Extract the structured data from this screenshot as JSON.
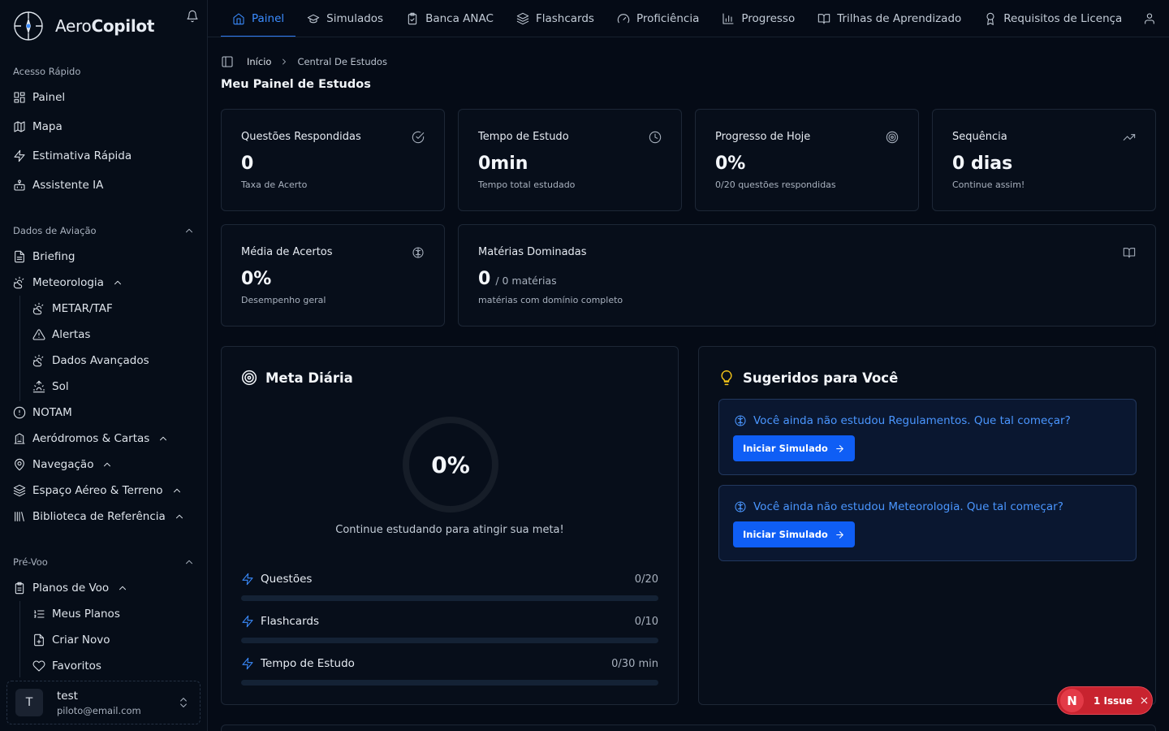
{
  "brand": {
    "name_light": "Aero",
    "name_bold": "Copilot"
  },
  "sidebar": {
    "quick_access_label": "Acesso Rápido",
    "quick_access": [
      {
        "label": "Painel",
        "icon": "grid-icon"
      },
      {
        "label": "Mapa",
        "icon": "map-icon"
      },
      {
        "label": "Estimativa Rápida",
        "icon": "zap-icon"
      },
      {
        "label": "Assistente IA",
        "icon": "bot-icon"
      }
    ],
    "aviation_label": "Dados de Aviação",
    "aviation": {
      "briefing": "Briefing",
      "meteorologia": "Meteorologia",
      "metar": "METAR/TAF",
      "alertas": "Alertas",
      "dados_avancados": "Dados Avançados",
      "sol": "Sol",
      "notam": "NOTAM",
      "aerodromos": "Aeródromos & Cartas",
      "navegacao": "Navegação",
      "espaco_aereo": "Espaço Aéreo & Terreno",
      "biblioteca": "Biblioteca de Referência"
    },
    "preflight_label": "Pré-Voo",
    "preflight": {
      "planos": "Planos de Voo",
      "meus_planos": "Meus Planos",
      "criar_novo": "Criar Novo",
      "favoritos": "Favoritos"
    },
    "user": {
      "initial": "T",
      "name": "test",
      "email": "piloto@email.com"
    }
  },
  "topnav": {
    "tabs": [
      {
        "label": "Painel",
        "active": true
      },
      {
        "label": "Simulados"
      },
      {
        "label": "Banca ANAC"
      },
      {
        "label": "Flashcards"
      },
      {
        "label": "Proficiência"
      },
      {
        "label": "Progresso"
      },
      {
        "label": "Trilhas de Aprendizado"
      },
      {
        "label": "Requisitos de Licença"
      }
    ]
  },
  "breadcrumb": {
    "home": "Início",
    "current": "Central De Estudos"
  },
  "page_title": "Meu Painel de Estudos",
  "stats": {
    "questoes": {
      "title": "Questões Respondidas",
      "value": "0",
      "sub": "Taxa de Acerto"
    },
    "tempo": {
      "title": "Tempo de Estudo",
      "value": "0min",
      "sub": "Tempo total estudado"
    },
    "progresso": {
      "title": "Progresso de Hoje",
      "value": "0%",
      "sub": "0/20 questões respondidas"
    },
    "sequencia": {
      "title": "Sequência",
      "value": "0 dias",
      "sub": "Continue assim!"
    },
    "media": {
      "title": "Média de Acertos",
      "value": "0%",
      "sub": "Desempenho geral"
    },
    "materias": {
      "title": "Matérias Dominadas",
      "value": "0",
      "of": "/ 0 matérias",
      "sub": "matérias com domínio completo"
    }
  },
  "goal": {
    "title": "Meta Diária",
    "percent_label": "0%",
    "percent": 0,
    "message": "Continue estudando para atingir sua meta!",
    "rows": [
      {
        "label": "Questões",
        "value": "0/20",
        "fraction": 0
      },
      {
        "label": "Flashcards",
        "value": "0/10",
        "fraction": 0
      },
      {
        "label": "Tempo de Estudo",
        "value": "0/30 min",
        "fraction": 0
      }
    ]
  },
  "suggestions": {
    "title": "Sugeridos para Você",
    "items": [
      {
        "text": "Você ainda não estudou Regulamentos. Que tal começar?",
        "button": "Iniciar Simulado"
      },
      {
        "text": "Você ainda não estudou Meteorologia. Que tal começar?",
        "button": "Iniciar Simulado"
      }
    ]
  },
  "issue_badge": {
    "letter": "N",
    "text": "1 Issue"
  },
  "colors": {
    "accent": "#2f7cf6",
    "background": "#050b16",
    "issue": "#c8232f"
  }
}
